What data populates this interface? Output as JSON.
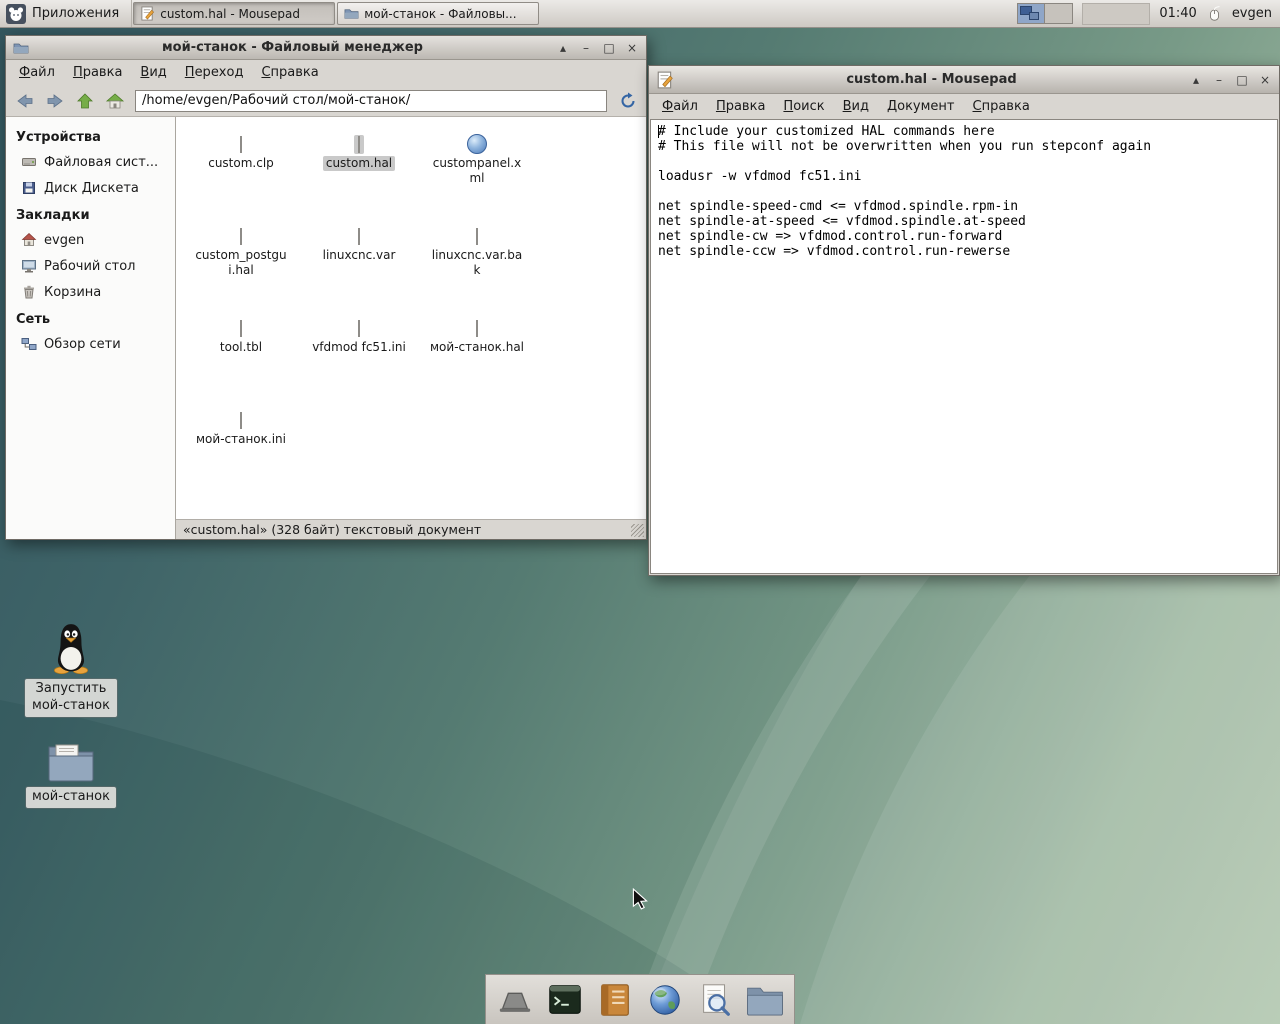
{
  "colors": {
    "selection_gray": "#c9c9c9",
    "panel_bg": "#d8d5d0",
    "accent_blue": "#5b87c5",
    "desktop_teal": "#3f6468"
  },
  "panel": {
    "applications_label": "Приложения",
    "taskbar": [
      {
        "label": "custom.hal - Mousepad",
        "active": true
      },
      {
        "label": "мой-станок - Файловы...",
        "active": false
      }
    ],
    "clock": "01:40",
    "username": "evgen"
  },
  "file_manager": {
    "title": "мой-станок - Файловый менеджер",
    "menu": [
      "Файл",
      "Правка",
      "Вид",
      "Переход",
      "Справка"
    ],
    "location": "/home/evgen/Рабочий стол/мой-станок/",
    "sidebar": {
      "sections": [
        {
          "header": "Устройства",
          "items": [
            {
              "label": "Файловая сист..."
            },
            {
              "label": "Диск Дискета"
            }
          ]
        },
        {
          "header": "Закладки",
          "items": [
            {
              "label": "evgen"
            },
            {
              "label": "Рабочий стол"
            },
            {
              "label": "Корзина"
            }
          ]
        },
        {
          "header": "Сеть",
          "items": [
            {
              "label": "Обзор сети"
            }
          ]
        }
      ]
    },
    "files": [
      {
        "name": "custom.clp"
      },
      {
        "name": "custom.hal",
        "selected": true
      },
      {
        "name": "custompanel.xml",
        "badge": "globe"
      },
      {
        "name": "custom_postgui.hal"
      },
      {
        "name": "linuxcnc.var"
      },
      {
        "name": "linuxcnc.var.bak"
      },
      {
        "name": "tool.tbl"
      },
      {
        "name": "vfdmod fc51.ini"
      },
      {
        "name": "мой-станок.hal"
      },
      {
        "name": "мой-станок.ini"
      }
    ],
    "statusbar": "«custom.hal» (328 байт) текстовый документ"
  },
  "editor": {
    "title": "custom.hal - Mousepad",
    "menu": [
      "Файл",
      "Правка",
      "Поиск",
      "Вид",
      "Документ",
      "Справка"
    ],
    "content": "# Include your customized HAL commands here\n# This file will not be overwritten when you run stepconf again\n\nloadusr -w vfdmod fc51.ini\n\nnet spindle-speed-cmd <= vfdmod.spindle.rpm-in\nnet spindle-at-speed <= vfdmod.spindle.at-speed\nnet spindle-cw => vfdmod.control.run-forward\nnet spindle-ccw => vfdmod.control.run-rewerse"
  },
  "desktop": {
    "icons": [
      {
        "label": "Запустить мой-станок",
        "icon": "tux-launcher-icon"
      },
      {
        "label": "мой-станок",
        "icon": "folder-icon"
      }
    ]
  },
  "dock": {
    "items": [
      "show-desktop",
      "terminal",
      "notes",
      "web-browser",
      "search",
      "file-manager"
    ]
  }
}
